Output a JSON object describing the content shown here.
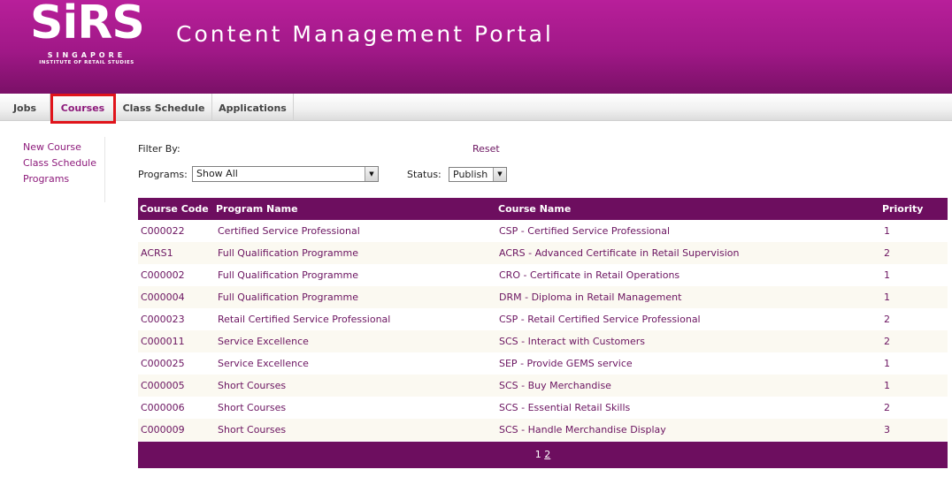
{
  "header": {
    "logo_text": "SiRS",
    "logo_sub1": "SINGAPORE",
    "logo_sub2": "INSTITUTE OF RETAIL STUDIES",
    "title": "Content Management Portal"
  },
  "tabs": [
    {
      "label": "Jobs"
    },
    {
      "label": "Courses",
      "active": true
    },
    {
      "label": "Class Schedule"
    },
    {
      "label": "Applications"
    }
  ],
  "sidebar": {
    "items": [
      {
        "label": "New Course"
      },
      {
        "label": "Class Schedule"
      },
      {
        "label": "Programs"
      }
    ]
  },
  "filters": {
    "filter_by_label": "Filter By:",
    "reset_label": "Reset",
    "programs_label": "Programs:",
    "programs_value": "Show All",
    "status_label": "Status:",
    "status_value": "Publish"
  },
  "table": {
    "columns": [
      "Course Code",
      "Program Name",
      "Course Name",
      "Priority"
    ],
    "rows": [
      [
        "C000022",
        "Certified Service Professional",
        "CSP - Certified Service Professional",
        "1"
      ],
      [
        "ACRS1",
        "Full Qualification Programme",
        "ACRS - Advanced Certificate in Retail Supervision",
        "2"
      ],
      [
        "C000002",
        "Full Qualification Programme",
        "CRO - Certificate in Retail Operations",
        "1"
      ],
      [
        "C000004",
        "Full Qualification Programme",
        "DRM - Diploma in Retail Management",
        "1"
      ],
      [
        "C000023",
        "Retail Certified Service Professional",
        "CSP - Retail Certified Service Professional",
        "2"
      ],
      [
        "C000011",
        "Service Excellence",
        "SCS - Interact with Customers",
        "2"
      ],
      [
        "C000025",
        "Service Excellence",
        "SEP - Provide GEMS service",
        "1"
      ],
      [
        "C000005",
        "Short Courses",
        "SCS - Buy Merchandise",
        "1"
      ],
      [
        "C000006",
        "Short Courses",
        "SCS - Essential Retail Skills",
        "2"
      ],
      [
        "C000009",
        "Short Courses",
        "SCS - Handle Merchandise Display",
        "3"
      ]
    ]
  },
  "pagination": {
    "current": "1",
    "other": "2"
  },
  "colors": {
    "brand": "#a01887",
    "header_row": "#6d0e5f",
    "link": "#6b1460",
    "highlight": "#e0141b"
  }
}
